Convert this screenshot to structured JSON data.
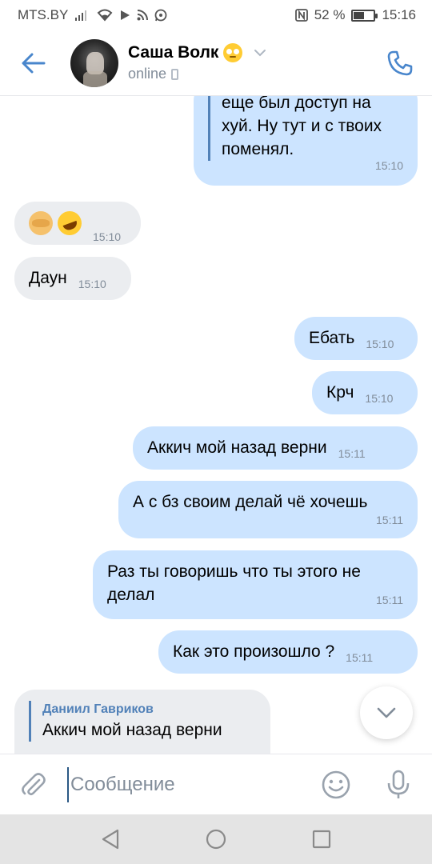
{
  "status_bar": {
    "carrier": "MTS.BY",
    "battery_percent": "52 %",
    "battery_level": 0.52,
    "time": "15:16",
    "icons": [
      "signal-icon",
      "wifi-icon",
      "play-icon",
      "rss-icon",
      "whatsapp-icon",
      "nfc-icon",
      "battery-icon"
    ]
  },
  "header": {
    "contact_name": "Саша Волк",
    "status": "online",
    "icons": [
      "back-arrow-icon",
      "avatar",
      "eye-roll-emoji-icon",
      "chevron-down-icon",
      "mobile-device-icon",
      "phone-call-icon"
    ]
  },
  "messages": [
    {
      "direction": "out",
      "text_lines": [
        "еще был доступ на",
        "хуй. Ну тут и с твоих",
        "поменял."
      ],
      "time": "15:10"
    },
    {
      "direction": "in",
      "emojis": [
        "facepalm-emoji-icon",
        "rofl-emoji-icon"
      ],
      "time": "15:10"
    },
    {
      "direction": "in",
      "text": "Даун",
      "time": "15:10"
    },
    {
      "direction": "out",
      "text": "Ебать",
      "time": "15:10"
    },
    {
      "direction": "out",
      "text": "Крч",
      "time": "15:10"
    },
    {
      "direction": "out",
      "text": "Аккич мой назад верни",
      "time": "15:11"
    },
    {
      "direction": "out",
      "text": "А с бз своим делай чё хочешь",
      "time": "15:11"
    },
    {
      "direction": "out",
      "text": "Раз ты говоришь что ты этого не делал",
      "time": "15:11"
    },
    {
      "direction": "out",
      "text": "Как это произошло ?",
      "time": "15:11"
    },
    {
      "direction": "in",
      "reply_author": "Даниил Гавриков",
      "reply_text": "Аккич мой назад верни"
    }
  ],
  "composer": {
    "placeholder": "Сообщение",
    "icons": [
      "paperclip-icon",
      "smile-icon",
      "microphone-icon"
    ]
  },
  "colors": {
    "accent": "#5181b8",
    "outgoing_bubble": "#cce4ff",
    "incoming_bubble": "#ebedf0",
    "secondary_text": "#818c99"
  }
}
